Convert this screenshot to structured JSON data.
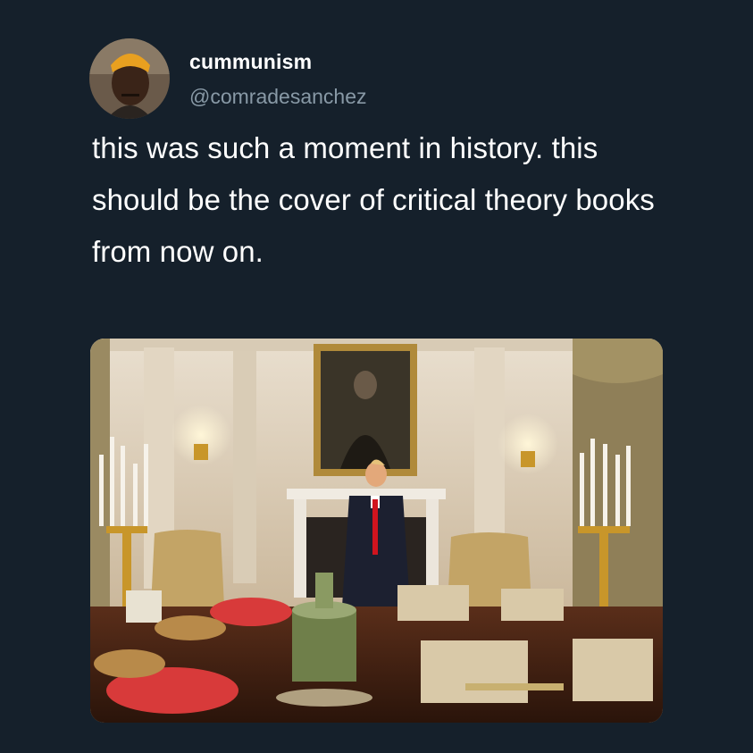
{
  "tweet": {
    "display_name": "cummunism",
    "handle": "@comradesanchez",
    "text": "this was such a moment in history. this should be the cover of critical theory books from now on.",
    "avatar_icon": "user-avatar-photo",
    "media_icon": "attached-photo"
  },
  "colors": {
    "background": "#15202b",
    "text_primary": "#ffffff",
    "text_secondary": "#8899a6"
  }
}
